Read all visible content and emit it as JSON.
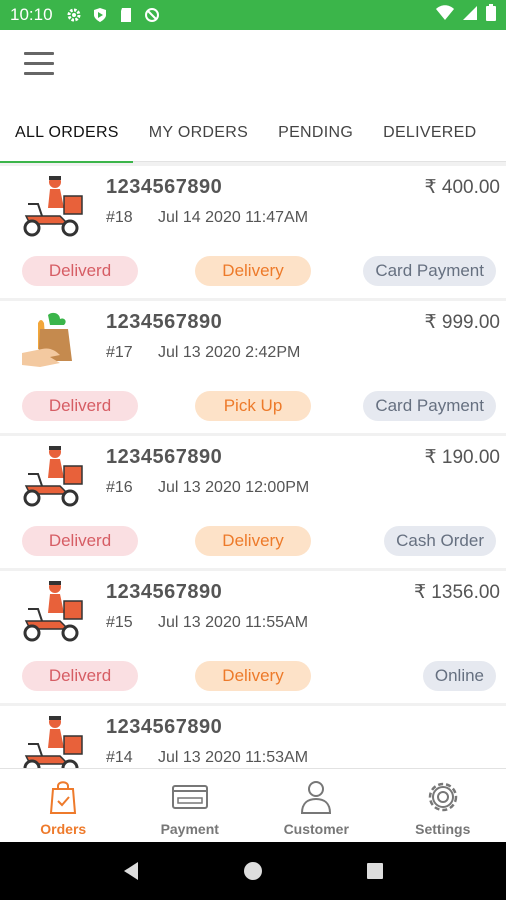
{
  "status_bar": {
    "time": "10:10"
  },
  "tabs": [
    {
      "label": "ALL ORDERS",
      "active": true
    },
    {
      "label": "MY ORDERS",
      "active": false
    },
    {
      "label": "PENDING",
      "active": false
    },
    {
      "label": "DELIVERED",
      "active": false
    }
  ],
  "orders": [
    {
      "phone": "1234567890",
      "number": "#18",
      "date": "Jul 14 2020 11:47AM",
      "amount": "₹  400.00",
      "status": "Deliverd",
      "type": "Delivery",
      "payment": "Card Payment",
      "icon": "delivery-scooter-icon"
    },
    {
      "phone": "1234567890",
      "number": "#17",
      "date": "Jul 13 2020  2:42PM",
      "amount": "₹  999.00",
      "status": "Deliverd",
      "type": "Pick Up",
      "payment": "Card Payment",
      "icon": "grocery-bag-icon"
    },
    {
      "phone": "1234567890",
      "number": "#16",
      "date": "Jul 13 2020 12:00PM",
      "amount": "₹  190.00",
      "status": "Deliverd",
      "type": "Delivery",
      "payment": "Cash Order",
      "icon": "delivery-scooter-icon"
    },
    {
      "phone": "1234567890",
      "number": "#15",
      "date": "Jul 13 2020 11:55AM",
      "amount": "₹  1356.00",
      "status": "Deliverd",
      "type": "Delivery",
      "payment": "Online",
      "icon": "delivery-scooter-icon"
    },
    {
      "phone": "1234567890",
      "number": "#14",
      "date": "Jul 13 2020 11:53AM",
      "amount": "",
      "status": "",
      "type": "",
      "payment": "",
      "icon": "delivery-scooter-icon"
    }
  ],
  "bottom_nav": [
    {
      "label": "Orders",
      "icon": "shopping-bag-icon",
      "active": true
    },
    {
      "label": "Payment",
      "icon": "card-icon",
      "active": false
    },
    {
      "label": "Customer",
      "icon": "user-icon",
      "active": false
    },
    {
      "label": "Settings",
      "icon": "gear-icon",
      "active": false
    }
  ],
  "colors": {
    "status_bar": "#3bb54a",
    "accent": "#ee7a2b",
    "tab_indicator": "#3bb54a"
  }
}
